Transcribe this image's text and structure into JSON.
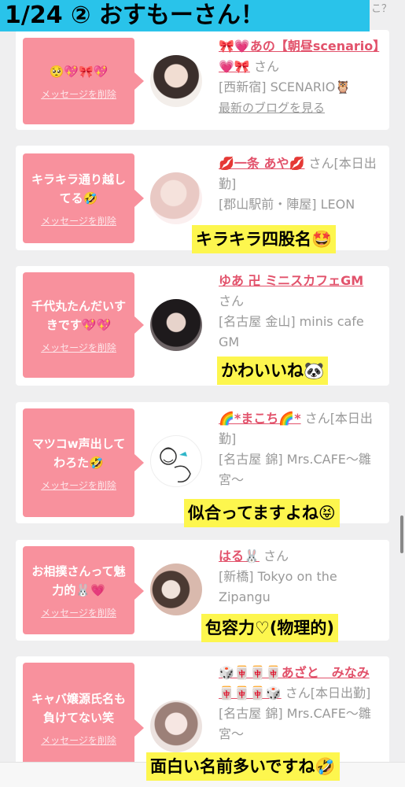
{
  "header": {
    "title": "1/24 ② おすもーさん！",
    "corner_link": "こ？"
  },
  "delete_label": "メッセージを削除",
  "cards": [
    {
      "message": "🥺💖🎀💖",
      "name": "🎀💗あの【朝昼scenario】💗🎀",
      "san": "さん",
      "shop": "[西新宿] SCENARIO🦉",
      "blog": "最新のブログを見る",
      "caption": ""
    },
    {
      "message": "キラキラ通り越してる🤣",
      "name": "💋一条 あや💋",
      "san": "さん[本日出勤]",
      "shop": "[郡山駅前・陣屋] LEON",
      "blog": "",
      "caption": "キラキラ四股名🤩"
    },
    {
      "message": "千代丸たんだいすきです💖💖",
      "name": "ゆあ 卍 ミニスカフェGM",
      "san": "さん",
      "shop": "[名古屋 金山] minis cafe GM",
      "blog": "",
      "caption": "かわいいね🐼"
    },
    {
      "message": "マツコw声出してわろた🤣",
      "name": "🌈*まこち🌈*",
      "san": "さん[本日出勤]",
      "shop": "[名古屋 錦] Mrs.CAFE〜雛宮〜",
      "blog": "",
      "caption": "似合ってますよね😝"
    },
    {
      "message": "お相撲さんって魅力的🐰💗",
      "name": "はる🐰",
      "san": "さん",
      "shop": "[新橋] Tokyo on the Zipangu",
      "blog": "",
      "caption": "包容力♡(物理的)"
    },
    {
      "message": "キャバ嬢源氏名も負けてない笑",
      "name": "🎲🀄🀄🀄あざと　みなみ🀄🀄🀄🎲",
      "san": "さん[本日出勤]",
      "shop": "[名古屋 錦] Mrs.CAFE〜雛宮〜",
      "blog": "",
      "caption": "面白い名前多いですね🤣"
    }
  ],
  "colors": {
    "accent": "#f8919d",
    "name": "#e2526b",
    "title_bg": "#29c3ea",
    "caption_bg": "#fdf64e"
  }
}
